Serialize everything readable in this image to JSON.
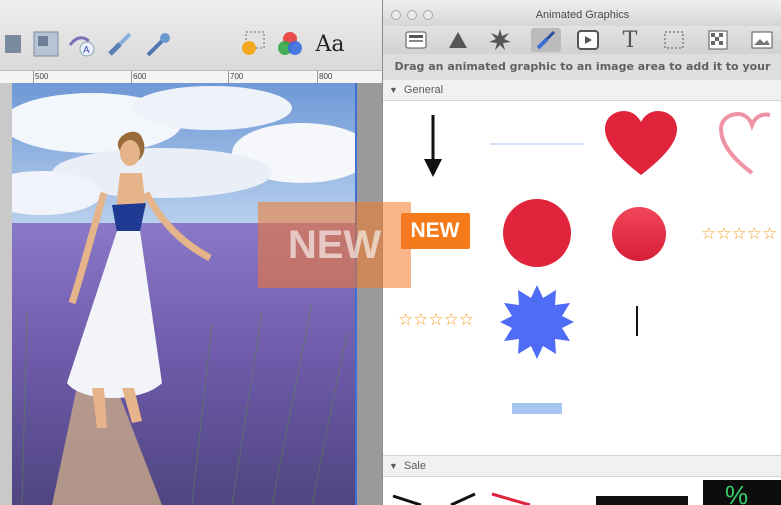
{
  "editor": {
    "toolbar_font_label": "Aa",
    "ruler": [
      "500",
      "600",
      "700",
      "800"
    ],
    "icons": [
      "layers-icon",
      "text-path-icon",
      "brush-icon",
      "eyedropper-icon",
      "effects-icon",
      "color-icon",
      "font-icon"
    ]
  },
  "panel": {
    "title": "Animated Graphics",
    "hint": "Drag an animated graphic to an image area to add it to your design.",
    "tools": [
      "text-box-tool",
      "shape-tool",
      "starburst-tool",
      "brush-tool",
      "media-tool",
      "text-tool",
      "selection-tool",
      "pattern-tool",
      "image-tool"
    ],
    "sections": [
      {
        "label": "General",
        "arrow": "▼"
      },
      {
        "label": "Sale",
        "arrow": "▼"
      }
    ],
    "new_badge": "NEW",
    "stars": "☆☆☆☆☆",
    "colors": {
      "red": "#e0243c",
      "blue_star": "#4e6cf5",
      "orange": "#f57a1a",
      "light_blue": "#a7c7f2"
    }
  },
  "drag": {
    "label": "NEW"
  }
}
